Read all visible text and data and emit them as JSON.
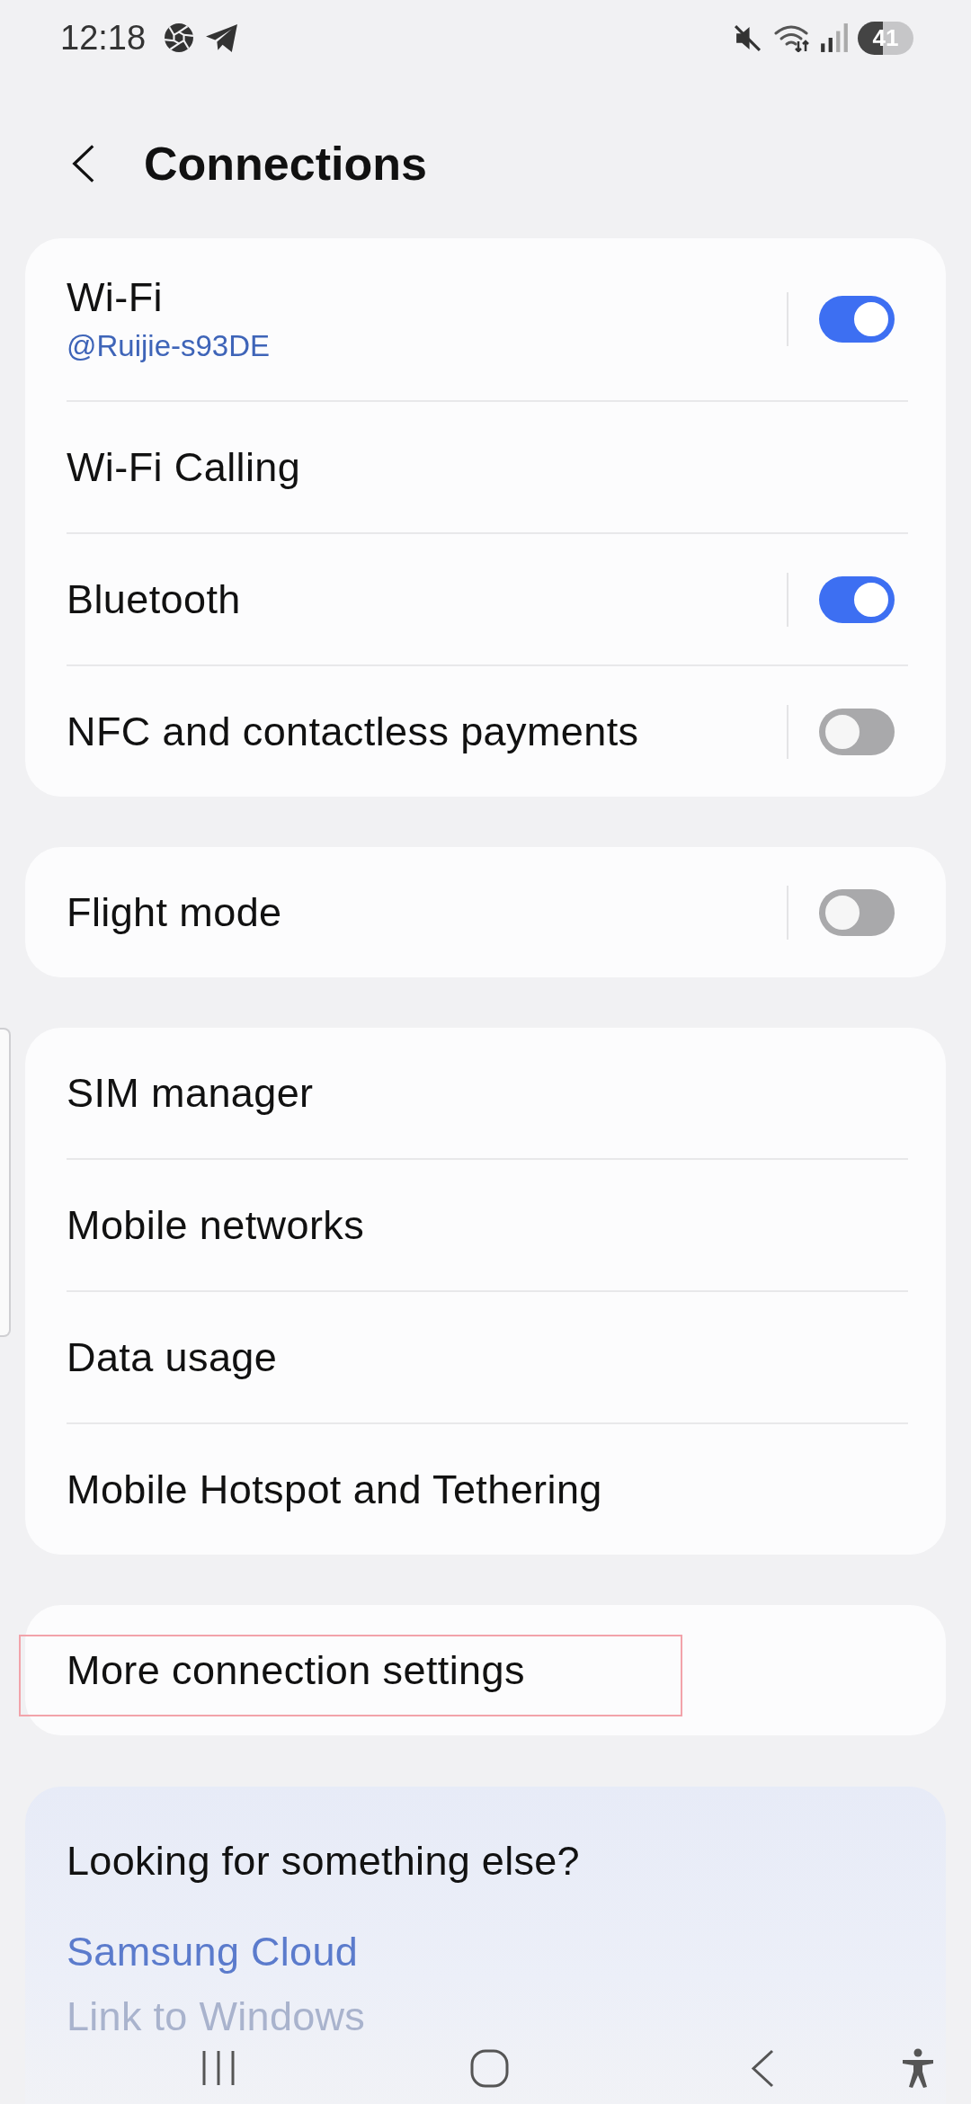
{
  "status_bar": {
    "time": "12:18",
    "battery": "41"
  },
  "header": {
    "title": "Connections"
  },
  "groups": [
    {
      "items": [
        {
          "kind": "toggle",
          "title": "Wi-Fi",
          "subtitle": "@Ruijie-s93DE",
          "on": true,
          "highlighted": false
        },
        {
          "kind": "link",
          "title": "Wi-Fi Calling",
          "highlighted": false
        },
        {
          "kind": "toggle",
          "title": "Bluetooth",
          "on": true,
          "highlighted": false
        },
        {
          "kind": "toggle",
          "title": "NFC and contactless payments",
          "on": false,
          "highlighted": false
        }
      ]
    },
    {
      "items": [
        {
          "kind": "toggle",
          "title": "Flight mode",
          "on": false,
          "highlighted": false
        }
      ]
    },
    {
      "items": [
        {
          "kind": "link",
          "title": "SIM manager",
          "highlighted": false
        },
        {
          "kind": "link",
          "title": "Mobile networks",
          "highlighted": false
        },
        {
          "kind": "link",
          "title": "Data usage",
          "highlighted": false
        },
        {
          "kind": "link",
          "title": "Mobile Hotspot and Tethering",
          "highlighted": false
        }
      ]
    },
    {
      "items": [
        {
          "kind": "link",
          "title": "More connection settings",
          "highlighted": true
        }
      ]
    }
  ],
  "suggestions": {
    "title": "Looking for something else?",
    "links": [
      {
        "label": "Samsung Cloud",
        "dimmed": false
      },
      {
        "label": "Link to Windows",
        "dimmed": true
      }
    ]
  }
}
